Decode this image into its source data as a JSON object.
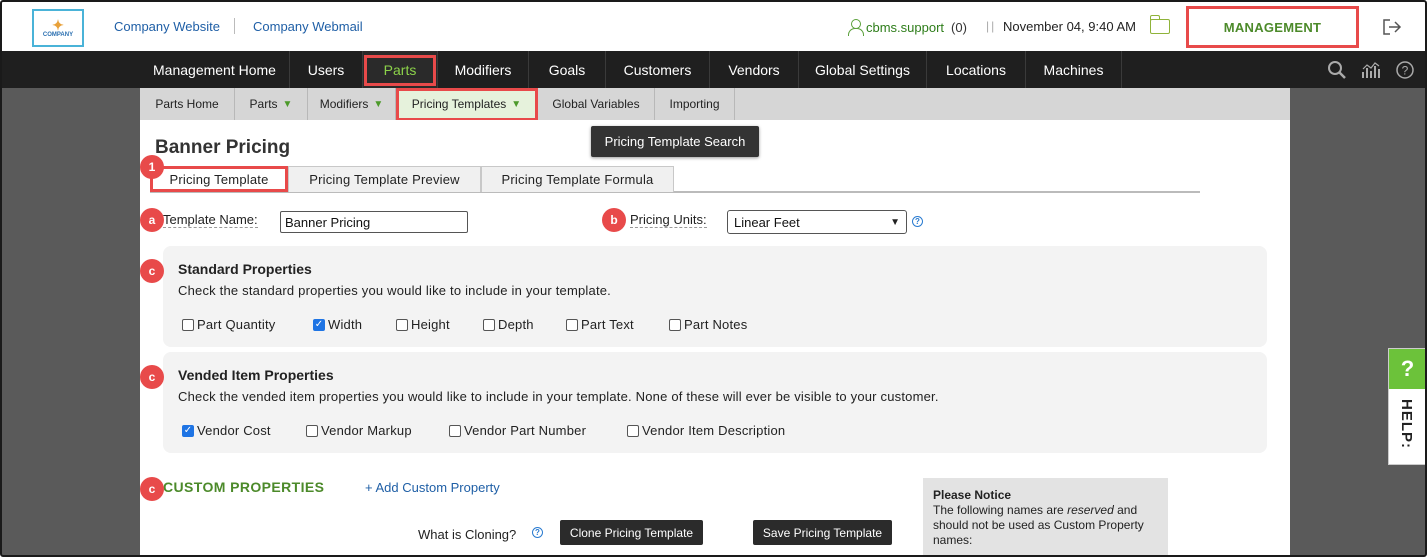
{
  "topbar": {
    "logo_text": "COMPANY",
    "links": [
      "Company Website",
      "Company Webmail"
    ],
    "user": "cbms.support",
    "user_count": "(0)",
    "datetime": "November 04, 9:40 AM",
    "management": "MANAGEMENT"
  },
  "mainnav": {
    "items": [
      "Management Home",
      "Users",
      "Parts",
      "Modifiers",
      "Goals",
      "Customers",
      "Vendors",
      "Global Settings",
      "Locations",
      "Machines"
    ]
  },
  "subnav": {
    "items": [
      "Parts Home",
      "Parts",
      "Modifiers",
      "Pricing Templates",
      "Global Variables",
      "Importing"
    ]
  },
  "tooltip": "Pricing Template Search",
  "page": {
    "title": "Banner Pricing",
    "tabs": [
      "Pricing Template",
      "Pricing Template Preview",
      "Pricing Template Formula"
    ]
  },
  "badges": {
    "tab": "1",
    "name": "a",
    "units": "b",
    "c": "c"
  },
  "form": {
    "template_name_label": "Template Name:",
    "template_name_value": "Banner Pricing",
    "pricing_units_label": "Pricing Units:",
    "pricing_units_value": "Linear Feet",
    "help_glyph": "?"
  },
  "standard": {
    "title": "Standard Properties",
    "desc": "Check the standard properties you would like to include in your template.",
    "options": [
      {
        "label": "Part Quantity",
        "checked": false
      },
      {
        "label": "Width",
        "checked": true
      },
      {
        "label": "Height",
        "checked": false
      },
      {
        "label": "Depth",
        "checked": false
      },
      {
        "label": "Part Text",
        "checked": false
      },
      {
        "label": "Part Notes",
        "checked": false
      }
    ]
  },
  "vended": {
    "title": "Vended Item Properties",
    "desc": "Check the vended item properties you would like to include in your template. None of these will ever be visible to your customer.",
    "options": [
      {
        "label": "Vendor Cost",
        "checked": true
      },
      {
        "label": "Vendor Markup",
        "checked": false
      },
      {
        "label": "Vendor Part Number",
        "checked": false
      },
      {
        "label": "Vendor Item Description",
        "checked": false
      }
    ]
  },
  "custom": {
    "title": "CUSTOM PROPERTIES",
    "add": "+ Add Custom Property",
    "clone_question": "What is Cloning?",
    "clone_button": "Clone Pricing Template",
    "save_button": "Save Pricing Template"
  },
  "notice": {
    "title": "Please Notice",
    "line1": "The following names are",
    "reserved": "reserved",
    "line1b": "and should not be used as Custom Property names:"
  },
  "help_tab": {
    "q": "?",
    "text": "HELP:"
  },
  "colors": {
    "accent_green": "#4c8a2a",
    "highlight_red": "#e84a4a",
    "checkbox_blue": "#1e74e4"
  }
}
